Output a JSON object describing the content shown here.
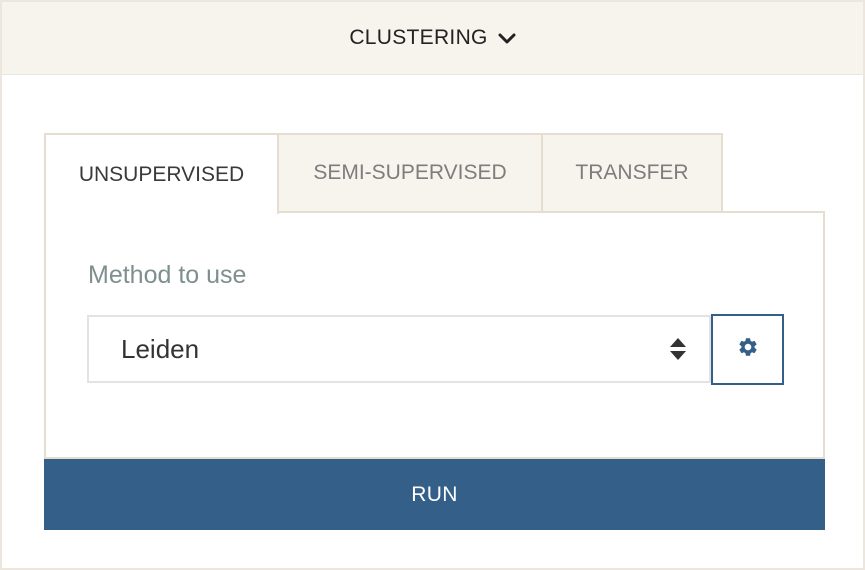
{
  "header": {
    "title": "CLUSTERING",
    "chevron_icon": "chevron-down-icon"
  },
  "tabs": [
    {
      "label": "UNSUPERVISED",
      "active": true
    },
    {
      "label": "SEMI-SUPERVISED",
      "active": false
    },
    {
      "label": "TRANSFER",
      "active": false
    }
  ],
  "method": {
    "label": "Method to use",
    "selected": "Leiden",
    "arrows_icon": "select-arrows-icon",
    "settings_icon": "gear-icon"
  },
  "run_button": {
    "label": "RUN"
  },
  "colors": {
    "accent": "#335f88",
    "header_bg": "#f7f3ed",
    "border": "#e6ddd1",
    "label": "#7e8f8f"
  }
}
